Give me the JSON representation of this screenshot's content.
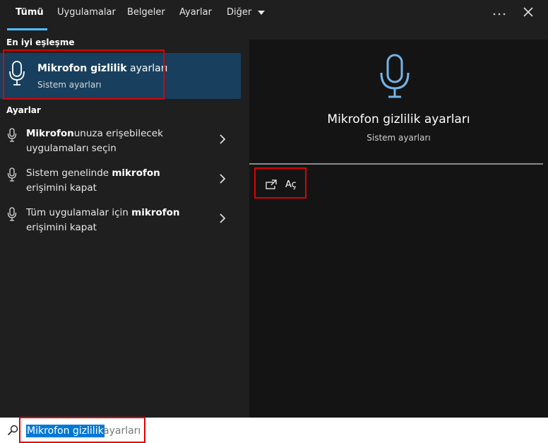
{
  "tabs": [
    {
      "label": "Tümü",
      "active": true
    },
    {
      "label": "Uygulamalar",
      "active": false
    },
    {
      "label": "Belgeler",
      "active": false
    },
    {
      "label": "Ayarlar",
      "active": false
    },
    {
      "label": "Diğer",
      "active": false
    }
  ],
  "topbar": {
    "more_icon": "ellipsis-icon",
    "close_icon": "close-icon"
  },
  "left": {
    "best_match_label": "En iyi eşleşme",
    "best_match": {
      "title_bold": "Mikrofon gizlilik",
      "title_rest": " ayarları",
      "subtitle": "Sistem ayarları",
      "icon": "microphone-icon"
    },
    "settings_label": "Ayarlar",
    "results": [
      {
        "bold": "Mikrofon",
        "rest": "unuza erişebilecek uygulamaları seçin",
        "pre": ""
      },
      {
        "pre": "Sistem genelinde ",
        "bold": "mikrofon",
        "rest": " erişimini kapat"
      },
      {
        "pre": "Tüm uygulamalar için ",
        "bold": "mikrofon",
        "rest": " erişimini kapat"
      }
    ]
  },
  "preview": {
    "title": "Mikrofon gizlilik ayarları",
    "subtitle": "Sistem ayarları",
    "open_label": "Aç",
    "icon": "microphone-icon"
  },
  "search": {
    "selected_text": "Mikrofon gizlilik",
    "suggestion_text": "ayarları",
    "icon": "search-icon"
  },
  "colors": {
    "accent": "#4cc2ff",
    "selection": "#0078d7",
    "highlight_box": "#e00000",
    "best_match_bg": "#18405e"
  }
}
